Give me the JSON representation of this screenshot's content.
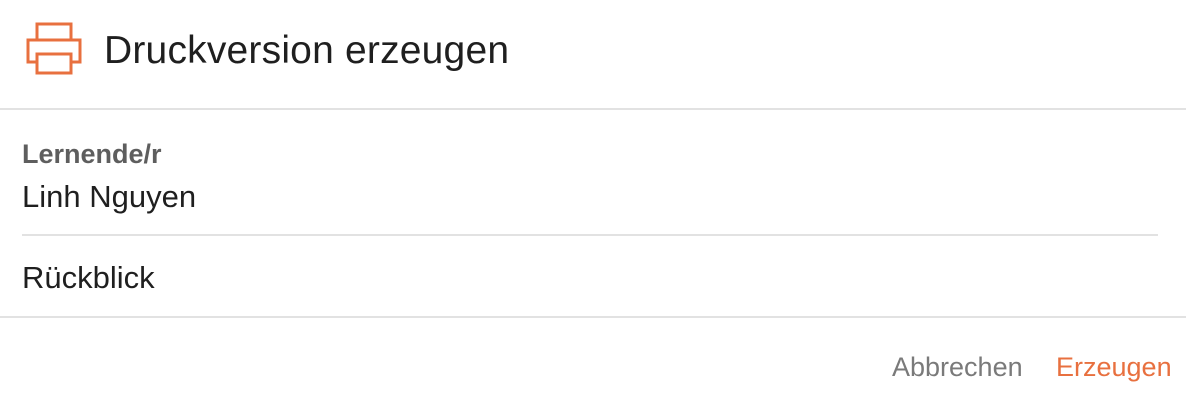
{
  "dialog": {
    "title": "Druckversion erzeugen",
    "icon": "printer-icon",
    "accent_color": "#e8703f"
  },
  "learner": {
    "label": "Lernende/r",
    "value": "Linh Nguyen"
  },
  "options": {
    "items": [
      {
        "label": "Rückblick"
      }
    ]
  },
  "footer": {
    "cancel_label": "Abbrechen",
    "create_label": "Erzeugen"
  }
}
